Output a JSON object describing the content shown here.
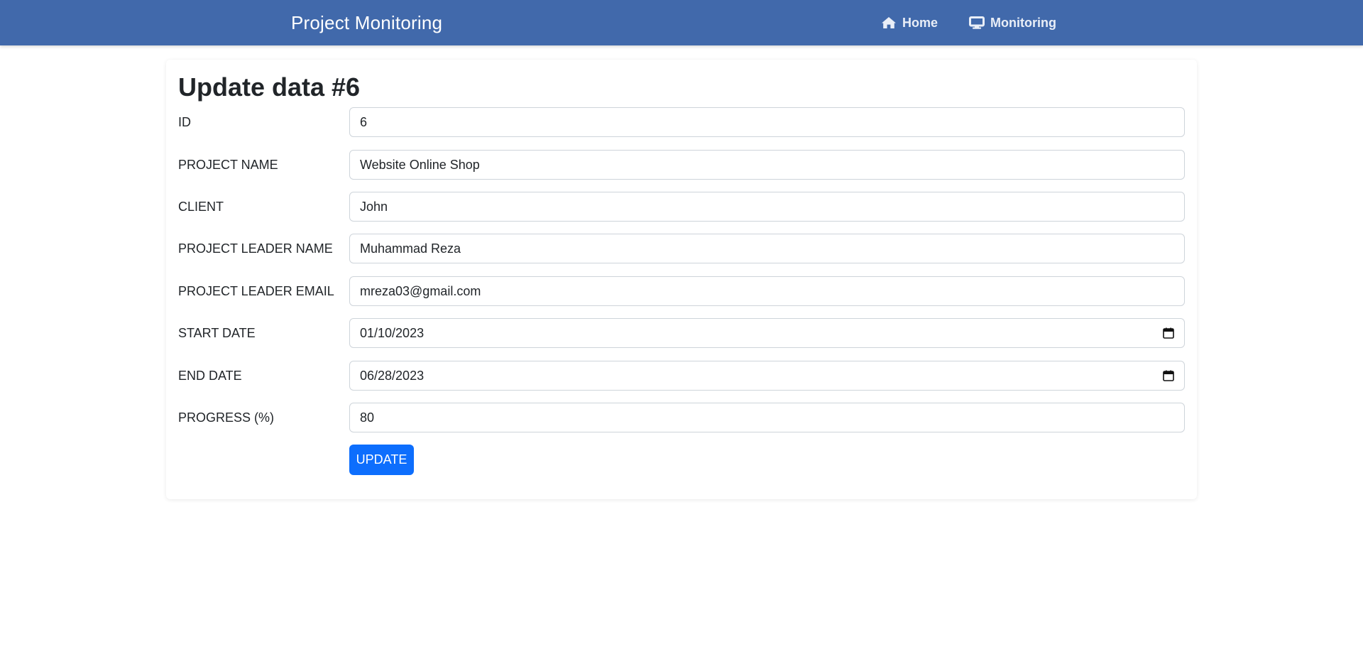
{
  "navbar": {
    "brand": "Project Monitoring",
    "links": [
      {
        "label": "Home",
        "icon": "home-icon"
      },
      {
        "label": "Monitoring",
        "icon": "desktop-icon"
      }
    ]
  },
  "form": {
    "title": "Update data #6",
    "fields": [
      {
        "label": "ID",
        "value": "6"
      },
      {
        "label": "PROJECT NAME",
        "value": "Website Online Shop"
      },
      {
        "label": "CLIENT",
        "value": "John"
      },
      {
        "label": "PROJECT LEADER NAME",
        "value": "Muhammad Reza"
      },
      {
        "label": "PROJECT LEADER EMAIL",
        "value": "mreza03@gmail.com"
      },
      {
        "label": "START DATE",
        "value": "01/10/2023",
        "icon": "calendar-icon"
      },
      {
        "label": "END DATE",
        "value": "06/28/2023",
        "icon": "calendar-icon"
      },
      {
        "label": "PROGRESS (%)",
        "value": "80"
      }
    ],
    "submit_label": "UPDATE"
  },
  "colors": {
    "navbar_bg": "#4169ab",
    "primary_button": "#0d6efd"
  }
}
